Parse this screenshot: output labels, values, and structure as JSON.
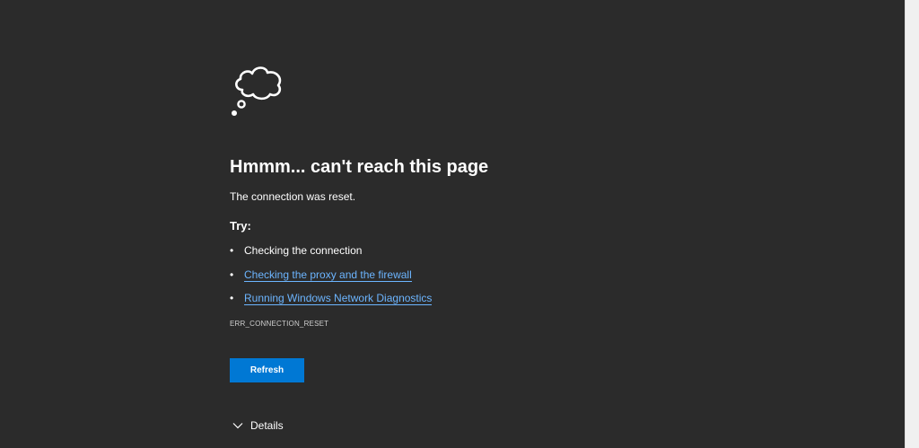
{
  "error_page": {
    "title": "Hmmm... can't reach this page",
    "message": "The connection was reset.",
    "try_heading": "Try:",
    "suggestions": [
      {
        "label": "Checking the connection",
        "is_link": false
      },
      {
        "label": "Checking the proxy and the firewall",
        "is_link": true
      },
      {
        "label": "Running Windows Network Diagnostics",
        "is_link": true
      }
    ],
    "error_code": "ERR_CONNECTION_RESET",
    "refresh_label": "Refresh",
    "details_label": "Details",
    "bullet": "•"
  },
  "icons": {
    "error": "thought-cloud-icon",
    "details": "chevron-down-icon"
  },
  "colors": {
    "background": "#2b2b2b",
    "text": "#ffffff",
    "link": "#6cb5ff",
    "button": "#0078d4"
  }
}
